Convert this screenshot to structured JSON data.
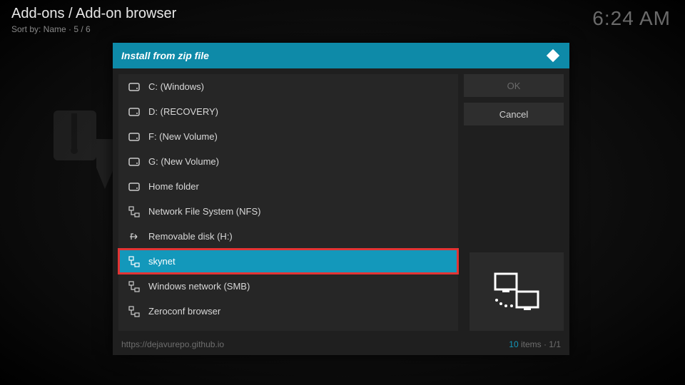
{
  "breadcrumb": "Add-ons / Add-on browser",
  "sortby": "Sort by: Name  ·  5 / 6",
  "clock": "6:24 AM",
  "dialog": {
    "title": "Install from zip file",
    "buttons": {
      "ok": "OK",
      "cancel": "Cancel"
    },
    "footer_path": "https://dejavurepo.github.io",
    "footer_count_num": "10",
    "footer_count_text": " items · 1/1",
    "items": [
      {
        "label": "C: (Windows)",
        "icon": "drive"
      },
      {
        "label": "D: (RECOVERY)",
        "icon": "drive"
      },
      {
        "label": "F: (New Volume)",
        "icon": "drive"
      },
      {
        "label": "G: (New Volume)",
        "icon": "drive"
      },
      {
        "label": "Home folder",
        "icon": "drive"
      },
      {
        "label": "Network File System (NFS)",
        "icon": "network"
      },
      {
        "label": "Removable disk (H:)",
        "icon": "usb"
      },
      {
        "label": "skynet",
        "icon": "network"
      },
      {
        "label": "Windows network (SMB)",
        "icon": "network"
      },
      {
        "label": "Zeroconf browser",
        "icon": "network"
      }
    ]
  }
}
